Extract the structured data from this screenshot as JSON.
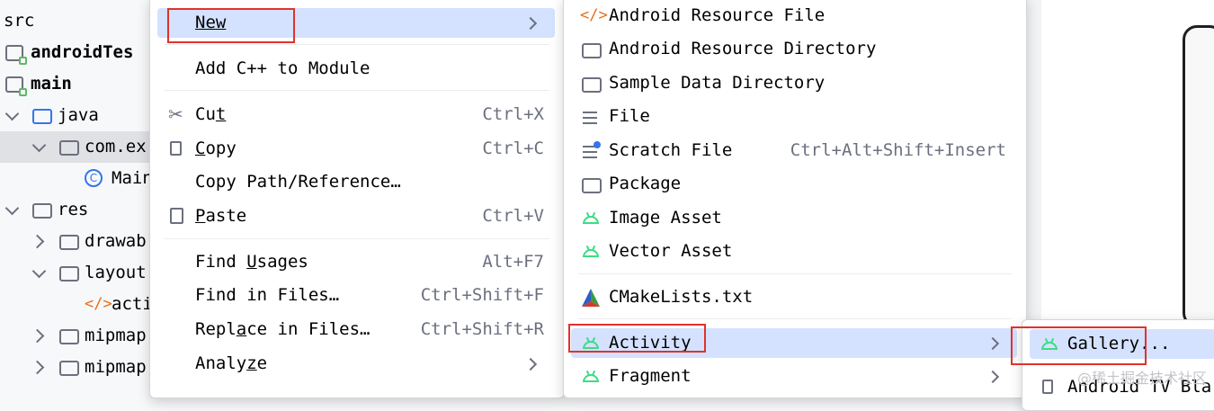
{
  "tree": {
    "items": [
      {
        "label": "src"
      },
      {
        "label": "androidTes"
      },
      {
        "label": "main"
      },
      {
        "label": "java"
      },
      {
        "label": "com.ex"
      },
      {
        "label": "Main"
      },
      {
        "label": "res"
      },
      {
        "label": "drawab"
      },
      {
        "label": "layout"
      },
      {
        "label": "acti"
      },
      {
        "label": "mipmap"
      },
      {
        "label": "mipmap"
      }
    ]
  },
  "context_menu": {
    "new": {
      "label": "New"
    },
    "add_cpp": {
      "label": "Add C++ to Module"
    },
    "cut": {
      "pre": "Cu",
      "u": "t",
      "post": "",
      "shortcut": "Ctrl+X"
    },
    "copy": {
      "pre": "",
      "u": "C",
      "post": "opy",
      "shortcut": "Ctrl+C"
    },
    "copy_path": {
      "label": "Copy Path/Reference…"
    },
    "paste": {
      "pre": "",
      "u": "P",
      "post": "aste",
      "shortcut": "Ctrl+V"
    },
    "find_usages": {
      "pre": "Find ",
      "u": "U",
      "post": "sages",
      "shortcut": "Alt+F7"
    },
    "find_in_files": {
      "label": "Find in Files…",
      "shortcut": "Ctrl+Shift+F"
    },
    "replace_in_files": {
      "pre": "Repl",
      "u": "a",
      "post": "ce in Files…",
      "shortcut": "Ctrl+Shift+R"
    },
    "analyze": {
      "pre": "Analy",
      "u": "z",
      "post": "e"
    }
  },
  "new_menu": {
    "items": [
      {
        "label": "Android Resource File"
      },
      {
        "label": "Android Resource Directory"
      },
      {
        "label": "Sample Data Directory"
      },
      {
        "label": "File"
      },
      {
        "label": "Scratch File",
        "shortcut": "Ctrl+Alt+Shift+Insert"
      },
      {
        "label": "Package"
      },
      {
        "label": "Image Asset"
      },
      {
        "label": "Vector Asset"
      },
      {
        "label": "CMakeLists.txt"
      },
      {
        "label": "Activity"
      },
      {
        "label": "Fragment"
      }
    ]
  },
  "activity_menu": {
    "items": [
      {
        "label": "Gallery..."
      },
      {
        "label": "Android TV Bla"
      }
    ]
  },
  "watermark": "@稀土掘金技术社区",
  "colors": {
    "highlight": "#d4e2ff",
    "accent": "#3574f0",
    "android_green": "#3ddc84",
    "red_box": "#e0322c"
  }
}
